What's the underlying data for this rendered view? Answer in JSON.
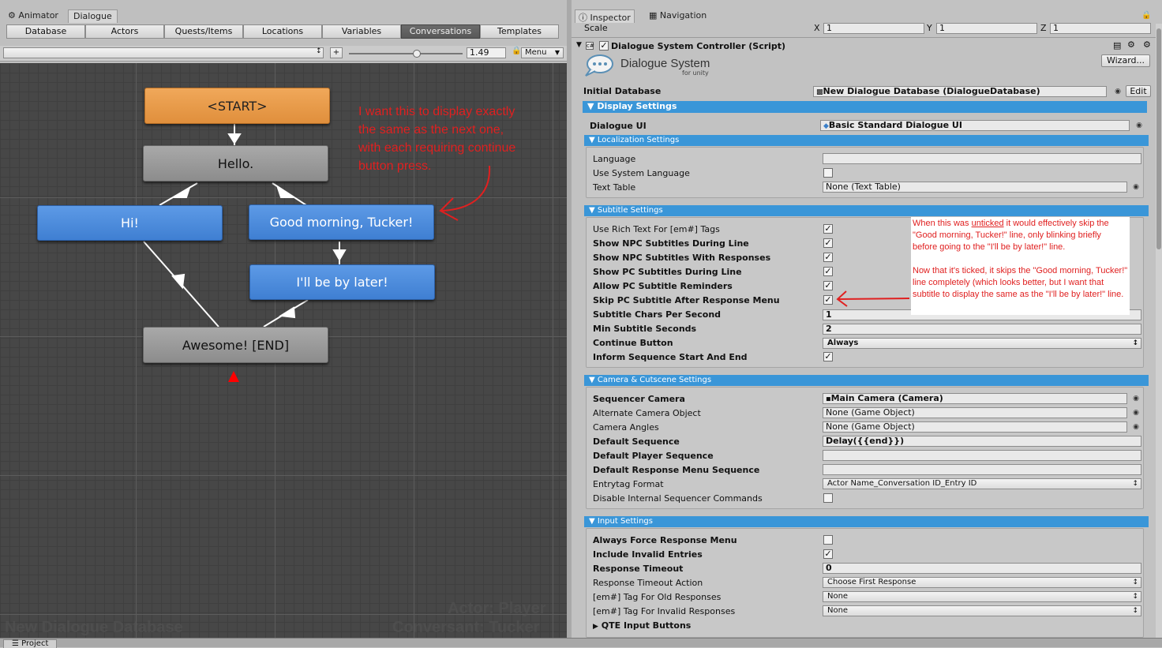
{
  "left_tabs": [
    "Animator",
    "Dialogue"
  ],
  "nav_tabs": [
    "Database",
    "Actors",
    "Quests/Items",
    "Locations",
    "Variables",
    "Conversations",
    "Templates"
  ],
  "toolbar": {
    "conversation_select": "",
    "add": "+",
    "zoom": "1.49",
    "menu": "Menu"
  },
  "zoom_level": 0.6,
  "nodes": {
    "start": "<START>",
    "hello": "Hello.",
    "hi": "Hi!",
    "good_morning": "Good morning, Tucker!",
    "later": "I'll be by later!",
    "awesome": "Awesome! [END]"
  },
  "annotation_left": [
    "I want this to display exactly",
    "the same as the next one,",
    "with each requiring continue",
    "button press."
  ],
  "watermarks": {
    "database": "New Dialogue Database",
    "actor": "Actor: Player",
    "conversant": "Conversant: Tucker"
  },
  "bottom_tab": "Project",
  "right_tabs": [
    "Inspector",
    "Navigation"
  ],
  "scale": {
    "label": "Scale",
    "x_label": "X",
    "x": "1",
    "y_label": "Y",
    "y": "1",
    "z_label": "Z",
    "z": "1"
  },
  "component": {
    "title": "Dialogue System Controller (Script)",
    "logo_main": "Dialogue System",
    "logo_sub": "for unity",
    "wizard": "Wizard..."
  },
  "initial_db": {
    "label": "Initial Database",
    "value": "New Dialogue Database (DialogueDatabase)",
    "edit": "Edit"
  },
  "display_settings": "Display Settings",
  "dialogue_ui": {
    "label": "Dialogue UI",
    "value": "Basic Standard Dialogue UI"
  },
  "localization": {
    "header": "Localization Settings",
    "language": "Language",
    "use_system_language": "Use System Language",
    "text_table": "Text Table",
    "text_table_value": "None (Text Table)"
  },
  "subtitle": {
    "header": "Subtitle Settings",
    "rows": [
      "Use Rich Text For [em#] Tags",
      "Show NPC Subtitles During Line",
      "Show NPC Subtitles With Responses",
      "Show PC Subtitles During Line",
      "Allow PC Subtitle Reminders",
      "Skip PC Subtitle After Response Menu"
    ],
    "chars_label": "Subtitle Chars Per Second",
    "chars_value": "1",
    "min_label": "Min Subtitle Seconds",
    "min_value": "2",
    "continue_label": "Continue Button",
    "continue_value": "Always",
    "inform_label": "Inform Sequence Start And End"
  },
  "annotation_right": {
    "p1_a": "When this was ",
    "p1_u": "unticked",
    "p1_b": " it would effectively skip the \"Good morning, Tucker!\" line, only blinking briefly before going to the \"I'll be by later!\" line.",
    "p2": "Now that it's ticked, it skips the \"Good morning, Tucker!\" line completely (which looks better, but I want that subtitle to display the same as the \"I'll be by later!\" line."
  },
  "camera": {
    "header": "Camera & Cutscene Settings",
    "seq_cam": "Sequencer Camera",
    "seq_cam_value": "Main Camera (Camera)",
    "alt_cam": "Alternate Camera Object",
    "alt_cam_value": "None (Game Object)",
    "angles": "Camera Angles",
    "angles_value": "None (Game Object)",
    "def_seq": "Default Sequence",
    "def_seq_value": "Delay({{end}})",
    "def_player": "Default Player Sequence",
    "def_resp": "Default Response Menu Sequence",
    "entrytag": "Entrytag Format",
    "entrytag_value": "Actor Name_Conversation ID_Entry ID",
    "disable": "Disable Internal Sequencer Commands"
  },
  "input": {
    "header": "Input Settings",
    "force": "Always Force Response Menu",
    "invalid": "Include Invalid Entries",
    "timeout": "Response Timeout",
    "timeout_value": "0",
    "timeout_action": "Response Timeout Action",
    "timeout_action_value": "Choose First Response",
    "old": "[em#] Tag For Old Responses",
    "old_value": "None",
    "inv_tag": "[em#] Tag For Invalid Responses",
    "inv_tag_value": "None",
    "qte": "QTE Input Buttons"
  },
  "colors": {
    "header_blue": "#3a96d8",
    "start_node": "#e8993f",
    "npc_node": "#9a9a9a",
    "pc_node": "#4a88dc",
    "annotation": "#e02020"
  }
}
